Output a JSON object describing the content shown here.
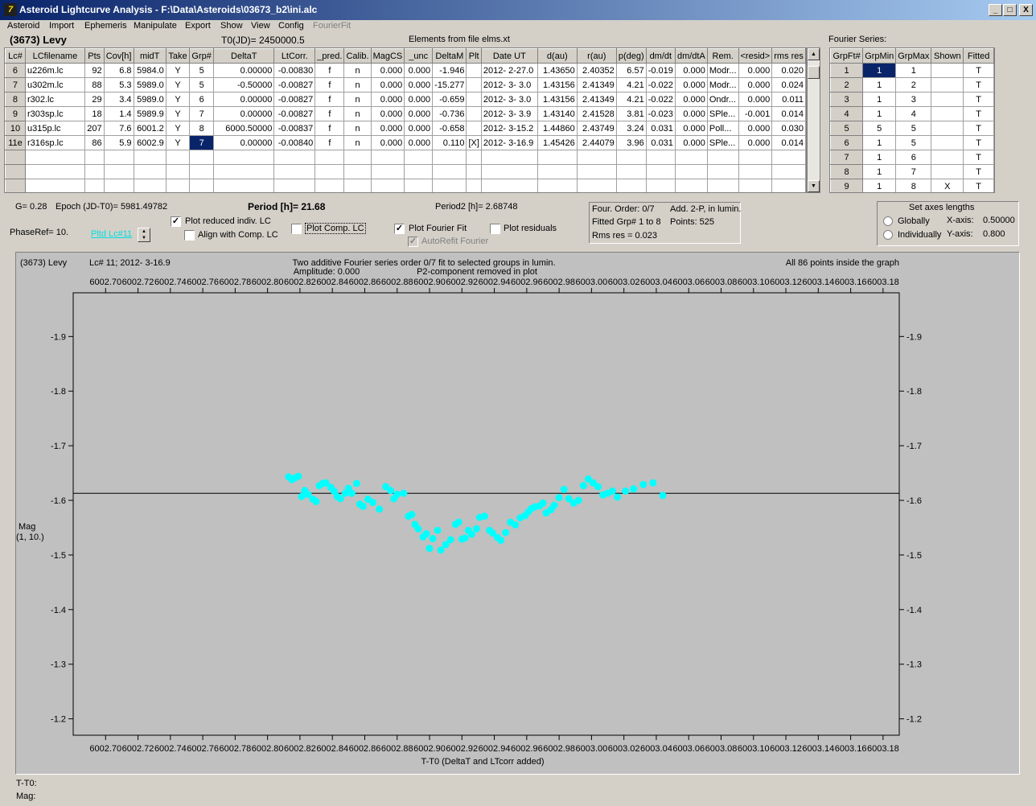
{
  "window": {
    "title": "Asteroid Lightcurve Analysis - F:\\Data\\Asteroids\\03673_b2\\ini.alc",
    "app_icon": "7",
    "minimize": "_",
    "maximize": "□",
    "close": "X"
  },
  "menu": [
    "Asteroid",
    "Import",
    "Ephemeris",
    "Manipulate",
    "Export",
    "Show",
    "View",
    "Config",
    "FourierFit"
  ],
  "header": {
    "asteroid": "(3673) Levy",
    "t0": "T0(JD)= 2450000.5",
    "elements": "Elements from file elms.xt"
  },
  "lc_table": {
    "columns": [
      "Lc#",
      "LCfilename",
      "Pts",
      "Cov[h]",
      "midT",
      "Take",
      "Grp#",
      "DeltaT",
      "LtCorr.",
      "_pred.",
      "Calib.",
      "MagCS",
      "_unc",
      "DeltaM",
      "Plt",
      "Date UT",
      "d(au)",
      "r(au)",
      "p(deg)",
      "dm/dt",
      "dm/dtA",
      "Rem.",
      "<resid>",
      "rms res"
    ],
    "rows": [
      [
        "6",
        "u226m.lc",
        "92",
        "6.8",
        "5984.0",
        "Y",
        "5",
        "0.00000",
        "-0.00830",
        "f",
        "n",
        "0.000",
        "0.000",
        "-1.946",
        "",
        "2012- 2-27.0",
        "1.43650",
        "2.40352",
        "6.57",
        "-0.019",
        "0.000",
        "Modr...",
        "0.000",
        "0.020"
      ],
      [
        "7",
        "u302m.lc",
        "88",
        "5.3",
        "5989.0",
        "Y",
        "5",
        "-0.50000",
        "-0.00827",
        "f",
        "n",
        "0.000",
        "0.000",
        "-15.277",
        "",
        "2012- 3- 3.0",
        "1.43156",
        "2.41349",
        "4.21",
        "-0.022",
        "0.000",
        "Modr...",
        "0.000",
        "0.024"
      ],
      [
        "8",
        "r302.lc",
        "29",
        "3.4",
        "5989.0",
        "Y",
        "6",
        "0.00000",
        "-0.00827",
        "f",
        "n",
        "0.000",
        "0.000",
        "-0.659",
        "",
        "2012- 3- 3.0",
        "1.43156",
        "2.41349",
        "4.21",
        "-0.022",
        "0.000",
        "Ondr...",
        "0.000",
        "0.011"
      ],
      [
        "9",
        "r303sp.lc",
        "18",
        "1.4",
        "5989.9",
        "Y",
        "7",
        "0.00000",
        "-0.00827",
        "f",
        "n",
        "0.000",
        "0.000",
        "-0.736",
        "",
        "2012- 3- 3.9",
        "1.43140",
        "2.41528",
        "3.81",
        "-0.023",
        "0.000",
        "SPle...",
        "-0.001",
        "0.014"
      ],
      [
        "10",
        "u315p.lc",
        "207",
        "7.6",
        "6001.2",
        "Y",
        "8",
        "6000.50000",
        "-0.00837",
        "f",
        "n",
        "0.000",
        "0.000",
        "-0.658",
        "",
        "2012- 3-15.2",
        "1.44860",
        "2.43749",
        "3.24",
        "0.031",
        "0.000",
        "Poll...",
        "0.000",
        "0.030"
      ],
      [
        "11e",
        "r316sp.lc",
        "86",
        "5.9",
        "6002.9",
        "Y",
        "7",
        "0.00000",
        "-0.00840",
        "f",
        "n",
        "0.000",
        "0.000",
        "0.110",
        "[X]",
        "2012- 3-16.9",
        "1.45426",
        "2.44079",
        "3.96",
        "0.031",
        "0.000",
        "SPle...",
        "0.000",
        "0.014"
      ]
    ]
  },
  "fourier_series": {
    "label": "Fourier Series:",
    "columns": [
      "GrpFt#",
      "GrpMin",
      "GrpMax",
      "Shown",
      "Fitted"
    ],
    "rows": [
      [
        "1",
        "1",
        "1",
        "",
        "T"
      ],
      [
        "2",
        "1",
        "2",
        "",
        "T"
      ],
      [
        "3",
        "1",
        "3",
        "",
        "T"
      ],
      [
        "4",
        "1",
        "4",
        "",
        "T"
      ],
      [
        "5",
        "5",
        "5",
        "",
        "T"
      ],
      [
        "6",
        "1",
        "5",
        "",
        "T"
      ],
      [
        "7",
        "1",
        "6",
        "",
        "T"
      ],
      [
        "8",
        "1",
        "7",
        "",
        "T"
      ],
      [
        "9",
        "1",
        "8",
        "X",
        "T"
      ]
    ]
  },
  "params": {
    "g": "G= 0.28",
    "epoch": "Epoch (JD-T0)= 5981.49782",
    "period": "Period [h]= 21.68",
    "period2": "Period2 [h]= 2.68748",
    "phaseref": "PhaseRef= 10.",
    "pltd": "Pltd Lc#11"
  },
  "options": {
    "plot_reduced": "Plot reduced indiv. LC",
    "align_comp": "Align with Comp. LC",
    "plot_comp": "Plot Comp. LC",
    "plot_fourier": "Plot Fourier Fit",
    "autorefit": "AutoRefit Fourier",
    "plot_residuals": "Plot residuals",
    "check_mark": "✓"
  },
  "fit_info": {
    "four_order": "Four. Order:  0/7",
    "add": "Add. 2-P, in lumin.",
    "fitted": "Fitted Grp# 1 to 8",
    "points": "Points: 525",
    "rms": "Rms res      = 0.023"
  },
  "axes_box": {
    "title": "Set axes lengths",
    "globally": "Globally",
    "individually": "Individually",
    "xaxis_label": "X-axis:",
    "xaxis_value": "0.50000",
    "yaxis_label": "Y-axis:",
    "yaxis_value": "0.800"
  },
  "chart_data": {
    "type": "scatter",
    "info_left": "(3673) Levy",
    "info_lc": "Lc# 11; 2012- 3-16.9",
    "info_title": "Two additive Fourier series order 0/7 fit to selected groups in lumin.",
    "info_amplitude": "Amplitude: 0.000",
    "info_p2": "P2-component removed in plot",
    "info_right": "All 86 points inside the graph",
    "xlabel": "T-T0 (DeltaT and LTcorr added)",
    "ylabel_1": "Mag",
    "ylabel_2": "(1, 10.)",
    "xlim": [
      6002.68,
      6003.19
    ],
    "ylim": [
      -1.98,
      -1.17
    ],
    "y_inverted": true,
    "x_ticks": [
      6002.7,
      6002.72,
      6002.74,
      6002.76,
      6002.78,
      6002.8,
      6002.82,
      6002.84,
      6002.86,
      6002.88,
      6002.9,
      6002.92,
      6002.94,
      6002.96,
      6002.98,
      6003.0,
      6003.02,
      6003.04,
      6003.06,
      6003.08,
      6003.1,
      6003.12,
      6003.14,
      6003.16,
      6003.18
    ],
    "x_tick_labels": [
      "6002.70",
      "6002.72",
      "6002.74",
      "6002.76",
      "6002.78",
      "6002.80",
      "6002.82",
      "6002.84",
      "6002.86",
      "6002.88",
      "6002.90",
      "6002.92",
      "6002.94",
      "6002.96",
      "6002.98",
      "6003.00",
      "6003.02",
      "6003.04",
      "6003.06",
      "6003.08",
      "6003.10",
      "6003.12",
      "6003.14",
      "6003.16",
      "6003.18"
    ],
    "y_ticks": [
      -1.9,
      -1.8,
      -1.7,
      -1.6,
      -1.5,
      -1.4,
      -1.3,
      -1.2
    ],
    "y_tick_labels": [
      "-1.9",
      "-1.8",
      "-1.7",
      "-1.6",
      "-1.5",
      "-1.4",
      "-1.3",
      "-1.2"
    ],
    "fit_line_y": -1.613,
    "point_color": "#00ffff",
    "background": "#c0c0c0",
    "x": [
      6002.813,
      6002.815,
      6002.817,
      6002.819,
      6002.821,
      6002.823,
      6002.825,
      6002.828,
      6002.83,
      6002.832,
      6002.834,
      6002.836,
      6002.839,
      6002.841,
      6002.843,
      6002.845,
      6002.848,
      6002.85,
      6002.852,
      6002.855,
      6002.857,
      6002.859,
      6002.862,
      6002.865,
      6002.869,
      6002.873,
      6002.876,
      6002.878,
      6002.88,
      6002.884,
      6002.887,
      6002.889,
      6002.891,
      6002.893,
      6002.896,
      6002.898,
      6002.9,
      6002.902,
      6002.905,
      6002.907,
      6002.91,
      6002.913,
      6002.916,
      6002.918,
      6002.92,
      6002.922,
      6002.924,
      6002.926,
      6002.929,
      6002.931,
      6002.934,
      6002.937,
      6002.939,
      6002.942,
      6002.944,
      6002.947,
      6002.95,
      6002.953,
      6002.956,
      6002.959,
      6002.961,
      6002.963,
      6002.965,
      6002.968,
      6002.97,
      6002.972,
      6002.975,
      6002.977,
      6002.98,
      6002.983,
      6002.986,
      6002.989,
      6002.992,
      6002.995,
      6002.998,
      6003.001,
      6003.004,
      6003.007,
      6003.01,
      6003.013,
      6003.016,
      6003.021,
      6003.026,
      6003.032,
      6003.038,
      6003.044
    ],
    "y": [
      -1.643,
      -1.638,
      -1.641,
      -1.644,
      -1.607,
      -1.618,
      -1.611,
      -1.602,
      -1.598,
      -1.627,
      -1.631,
      -1.632,
      -1.624,
      -1.617,
      -1.607,
      -1.603,
      -1.613,
      -1.622,
      -1.613,
      -1.631,
      -1.593,
      -1.589,
      -1.602,
      -1.596,
      -1.584,
      -1.625,
      -1.618,
      -1.603,
      -1.611,
      -1.613,
      -1.571,
      -1.574,
      -1.556,
      -1.548,
      -1.533,
      -1.539,
      -1.512,
      -1.53,
      -1.545,
      -1.509,
      -1.519,
      -1.528,
      -1.556,
      -1.56,
      -1.529,
      -1.531,
      -1.545,
      -1.538,
      -1.548,
      -1.569,
      -1.571,
      -1.545,
      -1.54,
      -1.532,
      -1.527,
      -1.541,
      -1.56,
      -1.555,
      -1.568,
      -1.572,
      -1.579,
      -1.585,
      -1.588,
      -1.59,
      -1.595,
      -1.577,
      -1.583,
      -1.591,
      -1.605,
      -1.62,
      -1.603,
      -1.595,
      -1.6,
      -1.627,
      -1.639,
      -1.632,
      -1.625,
      -1.61,
      -1.613,
      -1.617,
      -1.606,
      -1.617,
      -1.621,
      -1.629,
      -1.632,
      -1.609
    ]
  },
  "status": {
    "tt0": "T-T0:",
    "mag": "Mag:"
  }
}
